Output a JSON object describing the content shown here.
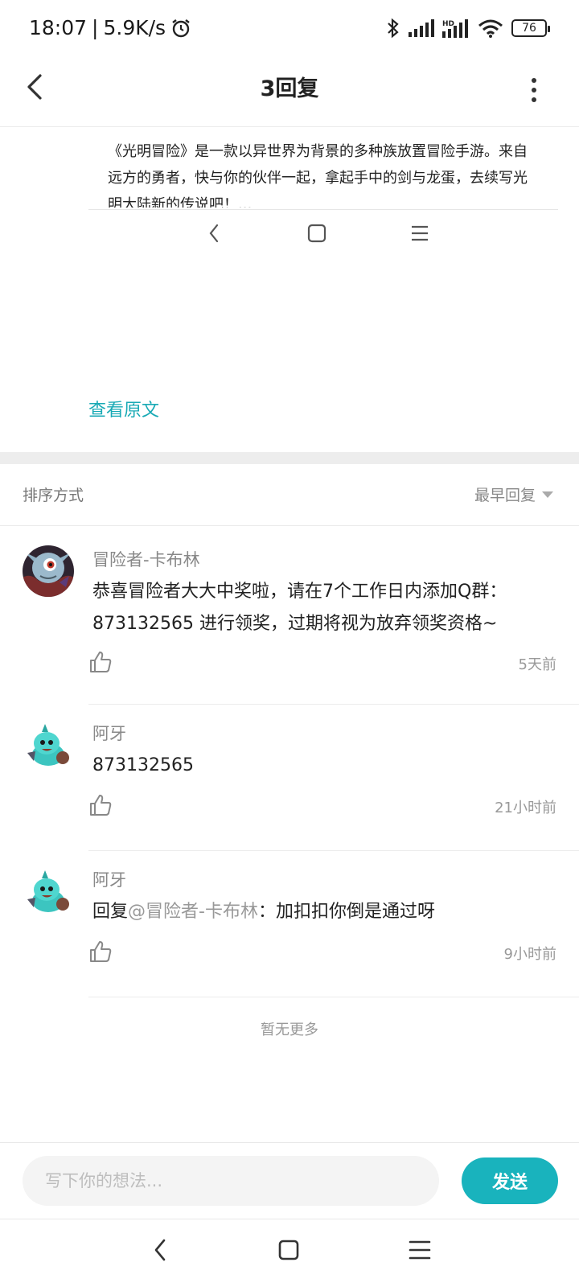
{
  "status_bar": {
    "time": "18:07",
    "speed": "5.9K/s",
    "battery": "76",
    "icons": [
      "alarm-icon",
      "bluetooth-icon",
      "signal-icon",
      "hd-signal-icon",
      "wifi-icon",
      "battery-icon"
    ]
  },
  "header": {
    "title": "3回复",
    "icons": [
      "back-arrow-icon",
      "more-vertical-icon"
    ]
  },
  "original_post": {
    "text": "《光明冒险》是一款以异世界为背景的多种族放置冒险手游。来自远方的勇者，快与你的伙伴一起，拿起手中的剑与龙蛋，去续写光明大陆新的传说吧！...",
    "view_original_label": "查看原文"
  },
  "sort": {
    "label": "排序方式",
    "selected": "最早回复"
  },
  "replies": [
    {
      "author": "冒险者-卡布林",
      "avatar": "goblin-avatar",
      "content": "恭喜冒险者大大中奖啦，请在7个工作日内添加Q群：873132565 进行领奖，过期将视为放弃领奖资格~",
      "time": "5天前"
    },
    {
      "author": "阿牙",
      "avatar": "dragon-avatar",
      "content": "873132565",
      "time": "21小时前"
    },
    {
      "author": "阿牙",
      "avatar": "dragon-avatar",
      "content_prefix": "回复",
      "mention": "@冒险者-卡布林",
      "content_suffix": "：加扣扣你倒是通过呀",
      "time": "9小时前"
    }
  ],
  "no_more": "暂无更多",
  "composer": {
    "placeholder": "写下你的想法...",
    "send_label": "发送"
  },
  "colors": {
    "accent": "#19b3bd",
    "link": "#19aab5"
  }
}
